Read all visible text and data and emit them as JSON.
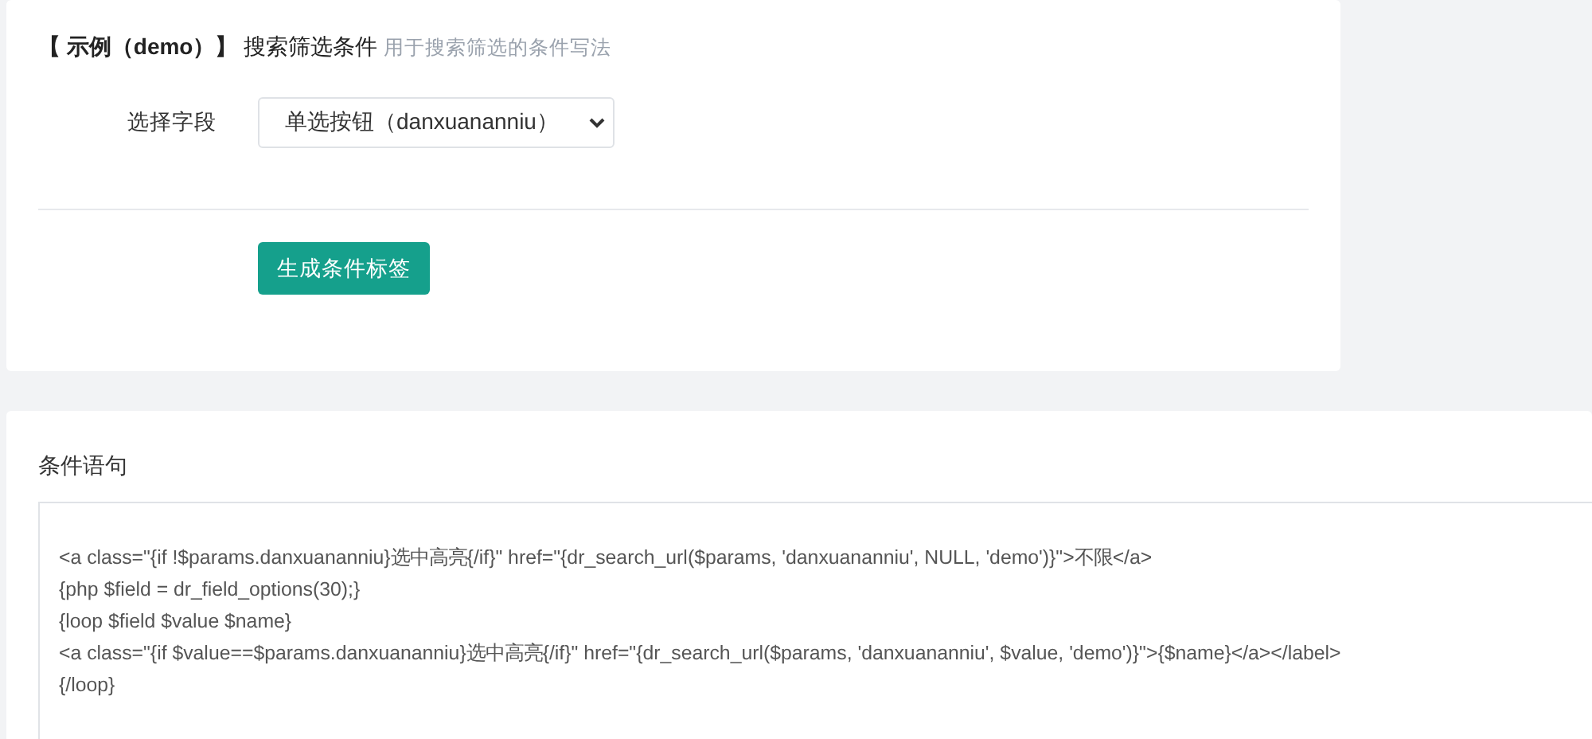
{
  "form_card": {
    "title_tag": "【 示例（demo）】",
    "title": "搜索筛选条件",
    "subtitle": "用于搜索筛选的条件写法",
    "field": {
      "label": "选择字段",
      "value": "单选按钮（danxuananniu）"
    },
    "button": "生成条件标签"
  },
  "result_card": {
    "label": "条件语句",
    "code_lines": [
      "<a class=\"{if !$params.danxuananniu}选中高亮{/if}\" href=\"{dr_search_url($params, 'danxuananniu', NULL, 'demo')}\">不限</a>",
      "{php $field = dr_field_options(30);}",
      "{loop $field $value $name}",
      "<a class=\"{if $value==$params.danxuananniu}选中高亮{/if}\" href=\"{dr_search_url($params, 'danxuananniu', $value, 'demo')}\">{$name}</a></label>",
      "{/loop}"
    ]
  }
}
